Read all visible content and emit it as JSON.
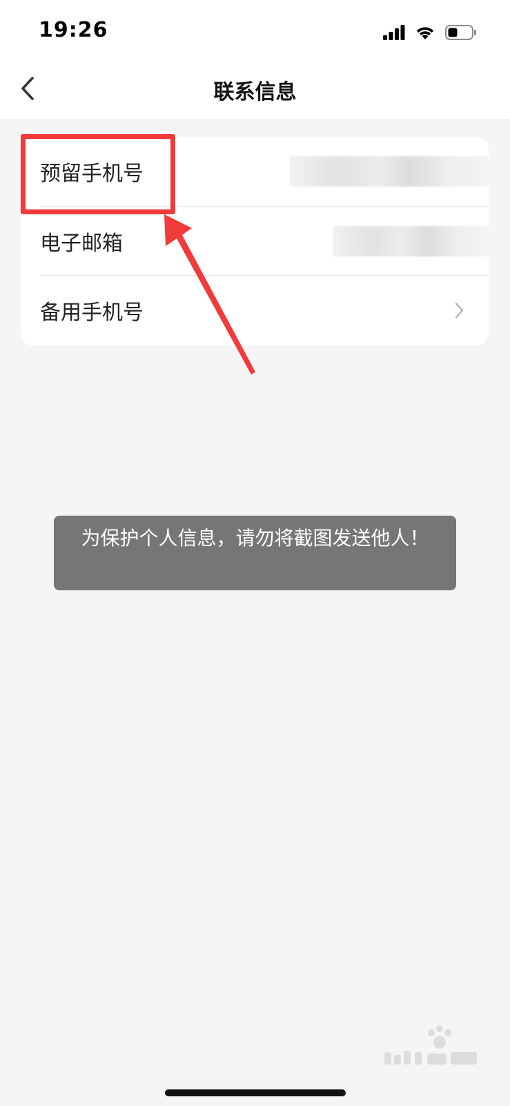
{
  "status_bar": {
    "time": "19:26"
  },
  "nav": {
    "title": "联系信息",
    "back_icon": "chevron-left-icon"
  },
  "contact_items": [
    {
      "label": "预留手机号"
    },
    {
      "label": "电子邮箱"
    },
    {
      "label": "备用手机号",
      "icon": "chevron-right-icon"
    }
  ],
  "toast": {
    "message": "为保护个人信息，请勿将截图发送他人！"
  },
  "annotation": {
    "color": "#f23a3a"
  },
  "colors": {
    "background": "#f5f5f5",
    "card": "#ffffff",
    "toast": "#646464"
  }
}
